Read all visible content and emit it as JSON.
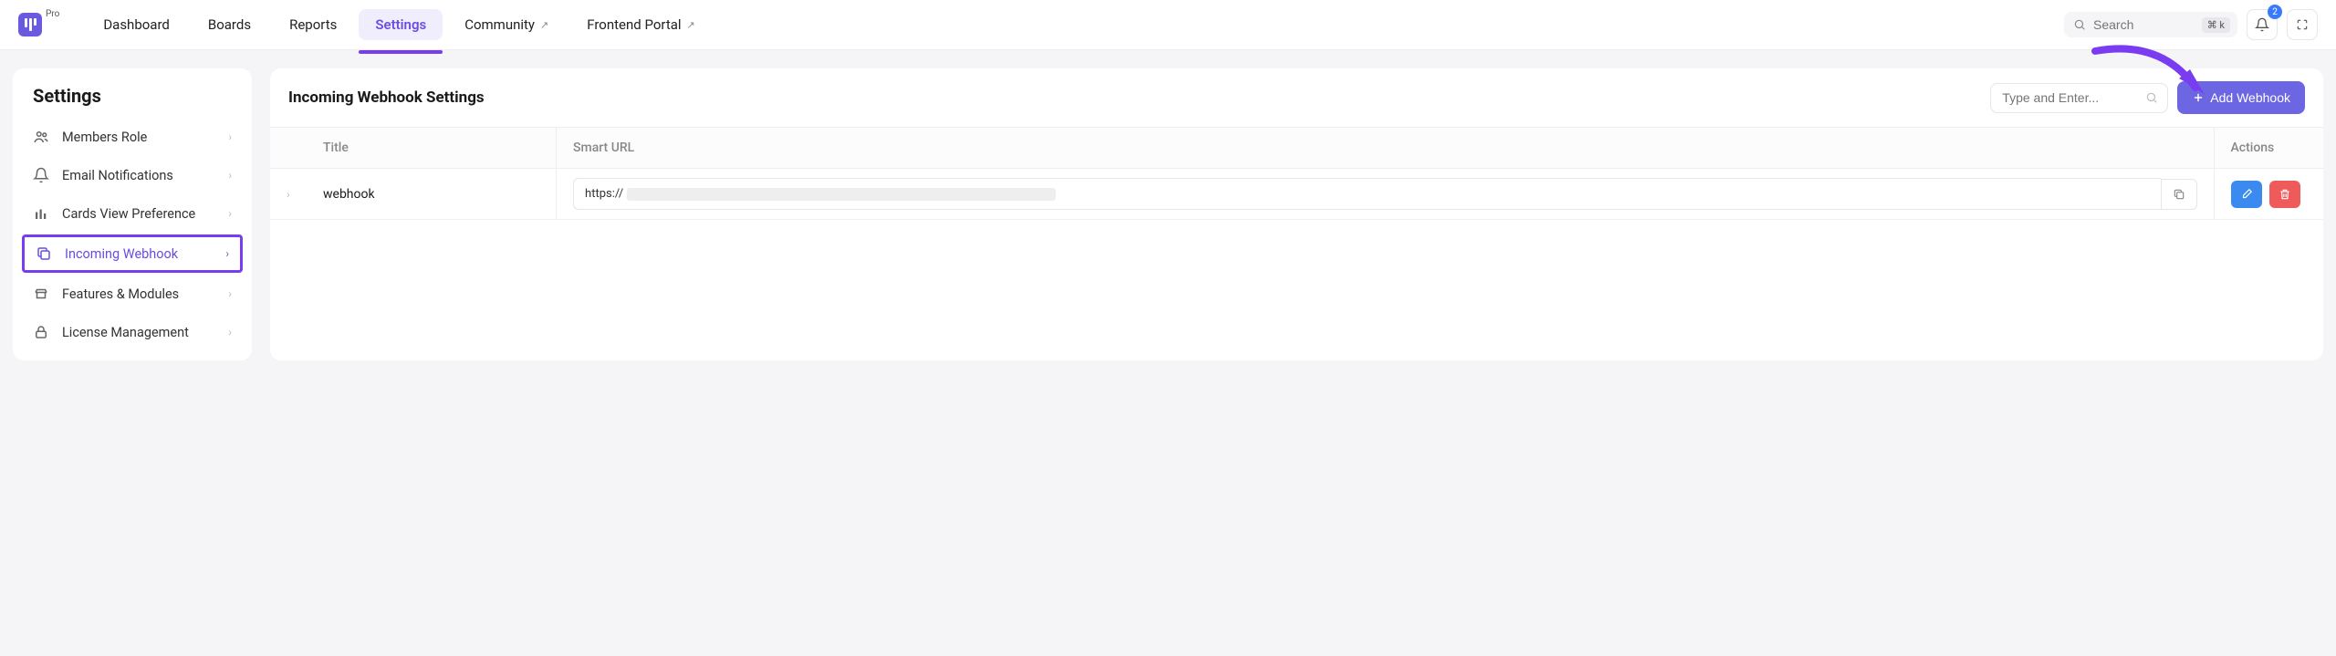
{
  "brand": {
    "pro_label": "Pro"
  },
  "nav": {
    "items": [
      {
        "label": "Dashboard",
        "active": false,
        "external": false
      },
      {
        "label": "Boards",
        "active": false,
        "external": false
      },
      {
        "label": "Reports",
        "active": false,
        "external": false
      },
      {
        "label": "Settings",
        "active": true,
        "external": false
      },
      {
        "label": "Community",
        "active": false,
        "external": true
      },
      {
        "label": "Frontend Portal",
        "active": false,
        "external": true
      }
    ]
  },
  "top_right": {
    "search_placeholder": "Search",
    "kbd_hint": "⌘ k",
    "notification_count": "2"
  },
  "sidebar": {
    "title": "Settings",
    "items": [
      {
        "label": "Members Role"
      },
      {
        "label": "Email Notifications"
      },
      {
        "label": "Cards View Preference"
      },
      {
        "label": "Incoming Webhook",
        "selected": true
      },
      {
        "label": "Features & Modules"
      },
      {
        "label": "License Management"
      }
    ]
  },
  "content": {
    "title": "Incoming Webhook Settings",
    "filter_placeholder": "Type and Enter...",
    "add_button": "Add Webhook"
  },
  "table": {
    "headers": {
      "title": "Title",
      "url": "Smart URL",
      "actions": "Actions"
    },
    "rows": [
      {
        "title": "webhook",
        "url_prefix": "https://"
      }
    ]
  }
}
